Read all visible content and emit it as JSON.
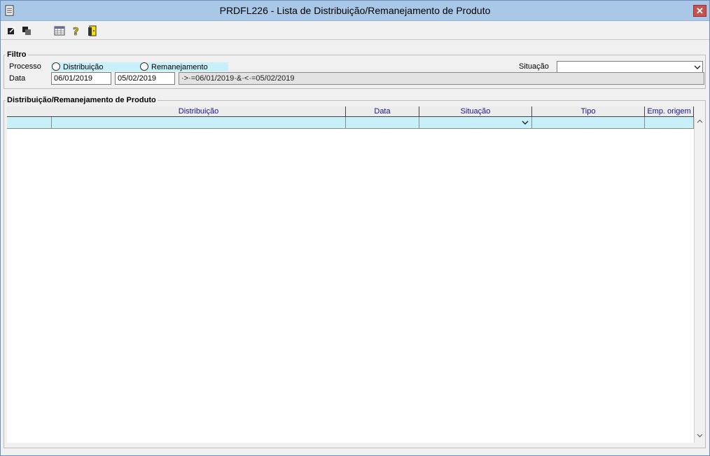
{
  "window": {
    "title": "PRDFL226 - Lista de Distribuição/Remanejamento de Produto",
    "close_label": "✕"
  },
  "toolbar": {
    "buttons": [
      {
        "name": "export-icon"
      },
      {
        "name": "copy-icon"
      },
      {
        "name": "grid-icon"
      },
      {
        "name": "help-icon"
      },
      {
        "name": "exit-door-icon"
      }
    ]
  },
  "filter": {
    "legend": "Filtro",
    "processo_label": "Processo",
    "radio_distribuicao": "Distribuição",
    "radio_remanejamento": "Remanejamento",
    "situacao_label": "Situação",
    "situacao_value": "",
    "data_label": "Data",
    "data_from": "06/01/2019",
    "data_to": "05/02/2019",
    "date_expression": "·>·=06/01/2019·&·<·=05/02/2019"
  },
  "list": {
    "legend": "Distribuição/Remanejamento de Produto",
    "columns": [
      "Distribuição",
      "Data",
      "Situação",
      "Tipo",
      "Emp. origem"
    ],
    "rows": [
      [
        "",
        "",
        "",
        "",
        ""
      ]
    ]
  },
  "colors": {
    "titlebar": "#a9c8e8",
    "row_highlight": "#c7f0f8",
    "header_text": "#14148c"
  }
}
